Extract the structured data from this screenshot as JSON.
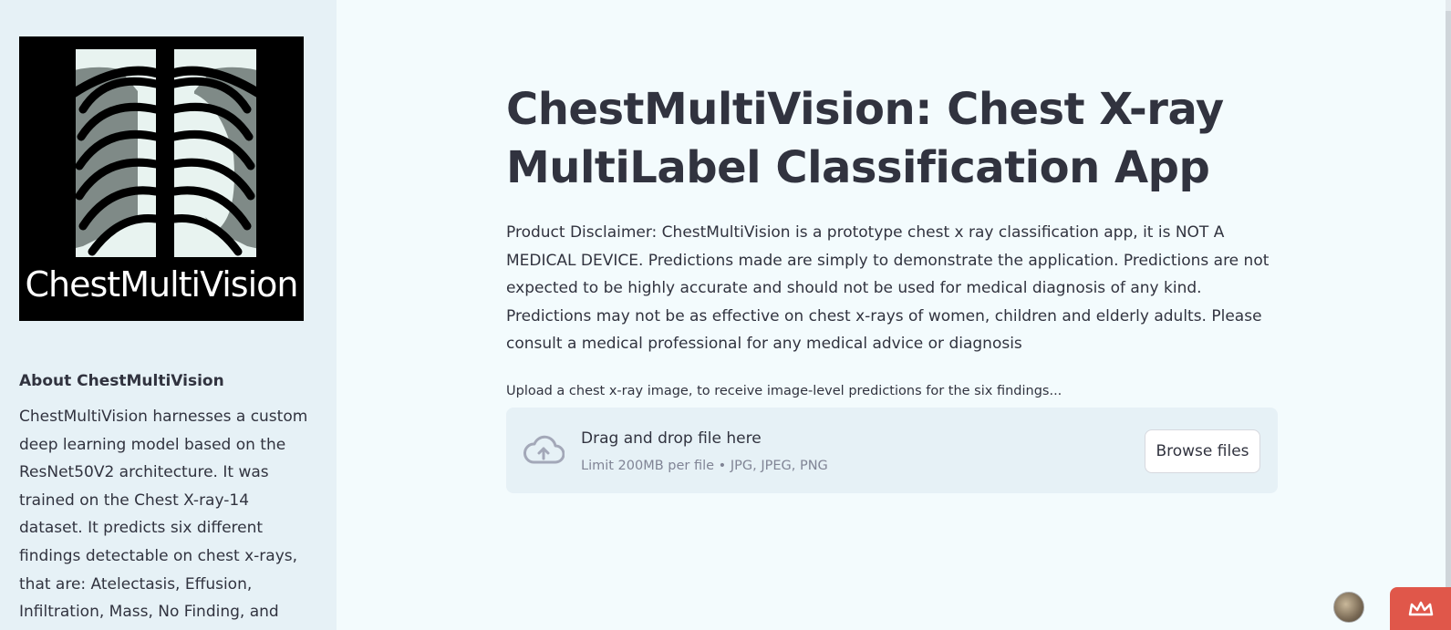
{
  "sidebar": {
    "logo_text": "ChestMultiVision",
    "about_title": "About ChestMultiVision",
    "about_text": "ChestMultiVision harnesses a custom deep learning model based on the ResNet50V2 architecture. It was trained on the Chest X-ray-14 dataset. It predicts six different findings detectable on chest x-rays, that are: Atelectasis, Effusion, Infiltration, Mass, No Finding, and Nodule."
  },
  "main": {
    "title_line1": "ChestMultiVision: Chest X-ray",
    "title_line2": "MultiLabel Classification App",
    "disclaimer": "Product Disclaimer: ChestMultiVision is a prototype chest x ray classification app, it is NOT A MEDICAL DEVICE. Predictions made are simply to demonstrate the application. Predictions are not expected to be highly accurate and should not be used for medical diagnosis of any kind. Predictions may not be as effective on chest x-rays of women, children and elderly adults. Please consult a medical professional for any medical advice or diagnosis",
    "upload_label": "Upload a chest x-ray image, to receive image-level predictions for the six findings...",
    "dropzone": {
      "title": "Drag and drop file here",
      "subtitle": "Limit 200MB per file • JPG, JPEG, PNG",
      "browse_label": "Browse files",
      "icon": "cloud-upload-icon"
    }
  },
  "footer": {
    "avatar_icon": "avatar",
    "badge_icon": "crown-icon"
  },
  "colors": {
    "sidebar_bg": "#e6f1f6",
    "main_bg": "#f3fbfd",
    "text": "#31333f",
    "muted": "#808495",
    "badge": "#e0574a"
  }
}
